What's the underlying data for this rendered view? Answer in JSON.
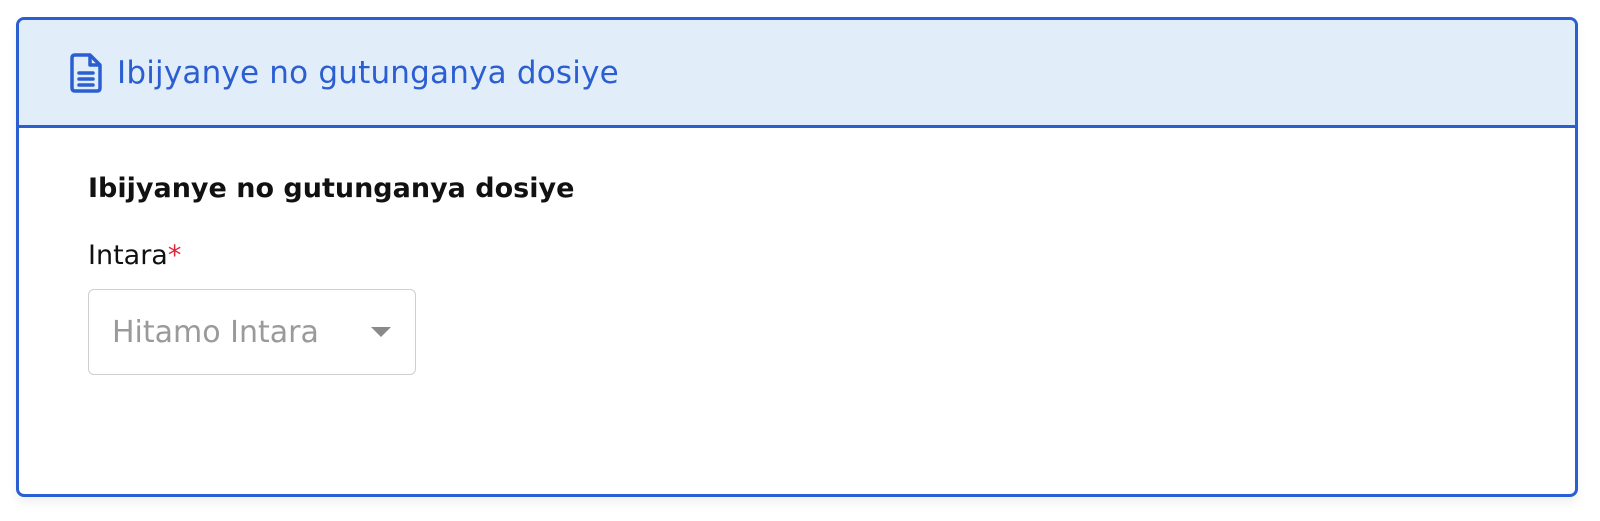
{
  "panel": {
    "header_title": "Ibijyanye no gutunganya dosiye",
    "header_icon": "document-icon"
  },
  "form": {
    "section_title": "Ibijyanye no gutunganya dosiye",
    "fields": [
      {
        "label": "Intara",
        "required_mark": "*",
        "placeholder": "Hitamo Intara",
        "icon": "chevron-down-icon"
      }
    ]
  },
  "colors": {
    "accent": "#2b5fd1",
    "header_bg": "#e1edf9",
    "required": "#e0243a",
    "placeholder": "#9a9a9a"
  }
}
